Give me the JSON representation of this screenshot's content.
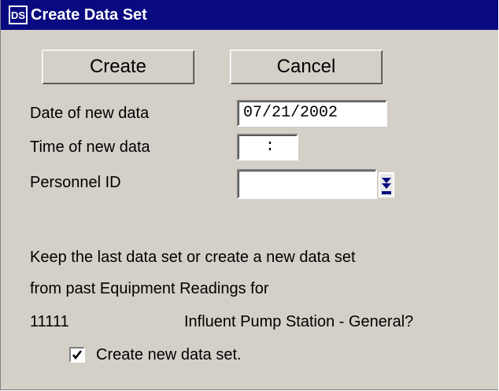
{
  "window": {
    "title": "Create Data Set",
    "icon": "app-logo-icon"
  },
  "buttons": {
    "create_label": "Create",
    "cancel_label": "Cancel"
  },
  "form": {
    "date_label": "Date of new data",
    "date_value": "07/21/2002",
    "time_label": "Time of new data",
    "time_value": ":",
    "personnel_label": "Personnel ID",
    "personnel_value": ""
  },
  "message": {
    "line1": "Keep the last data set or create a new data set",
    "line2": "from past Equipment Readings for",
    "station_id": "11111",
    "station_name": "Influent Pump Station - General?"
  },
  "option": {
    "label": "Create new data set.",
    "checked": true
  },
  "colors": {
    "titlebar": "#0a0a80",
    "window_bg": "#d4d0c8",
    "field_bg": "#ffffff"
  }
}
